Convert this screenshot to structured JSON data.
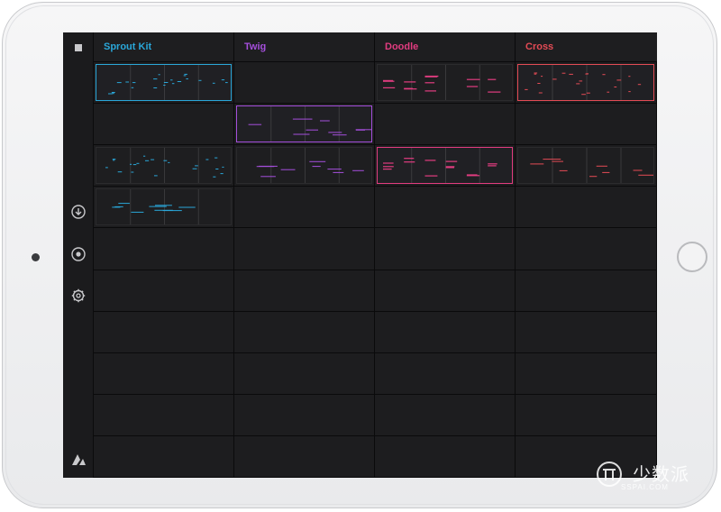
{
  "app": {
    "columns": [
      {
        "name": "Sprout Kit",
        "color": "#2aa7d9"
      },
      {
        "name": "Twig",
        "color": "#a54fdc"
      },
      {
        "name": "Doodle",
        "color": "#e23c80"
      },
      {
        "name": "Cross",
        "color": "#e44b55"
      }
    ],
    "rows": 10,
    "clips": [
      {
        "col": 0,
        "row": 0,
        "style": "dots",
        "active": true
      },
      {
        "col": 2,
        "row": 0,
        "style": "bars",
        "active": false
      },
      {
        "col": 3,
        "row": 0,
        "style": "dots",
        "active": true
      },
      {
        "col": 1,
        "row": 1,
        "style": "lines",
        "active": true
      },
      {
        "col": 0,
        "row": 2,
        "style": "dots",
        "active": false
      },
      {
        "col": 1,
        "row": 2,
        "style": "lines",
        "active": false
      },
      {
        "col": 2,
        "row": 2,
        "style": "bars",
        "active": true
      },
      {
        "col": 3,
        "row": 2,
        "style": "lines",
        "active": false
      },
      {
        "col": 0,
        "row": 3,
        "style": "lines",
        "active": false
      }
    ],
    "sidebar_icons": [
      "stop-icon",
      "download-icon",
      "record-icon",
      "settings-gear-icon",
      "app-logo-icon"
    ]
  },
  "watermark": {
    "text": "少数派",
    "sub": "SSPAI.COM"
  }
}
